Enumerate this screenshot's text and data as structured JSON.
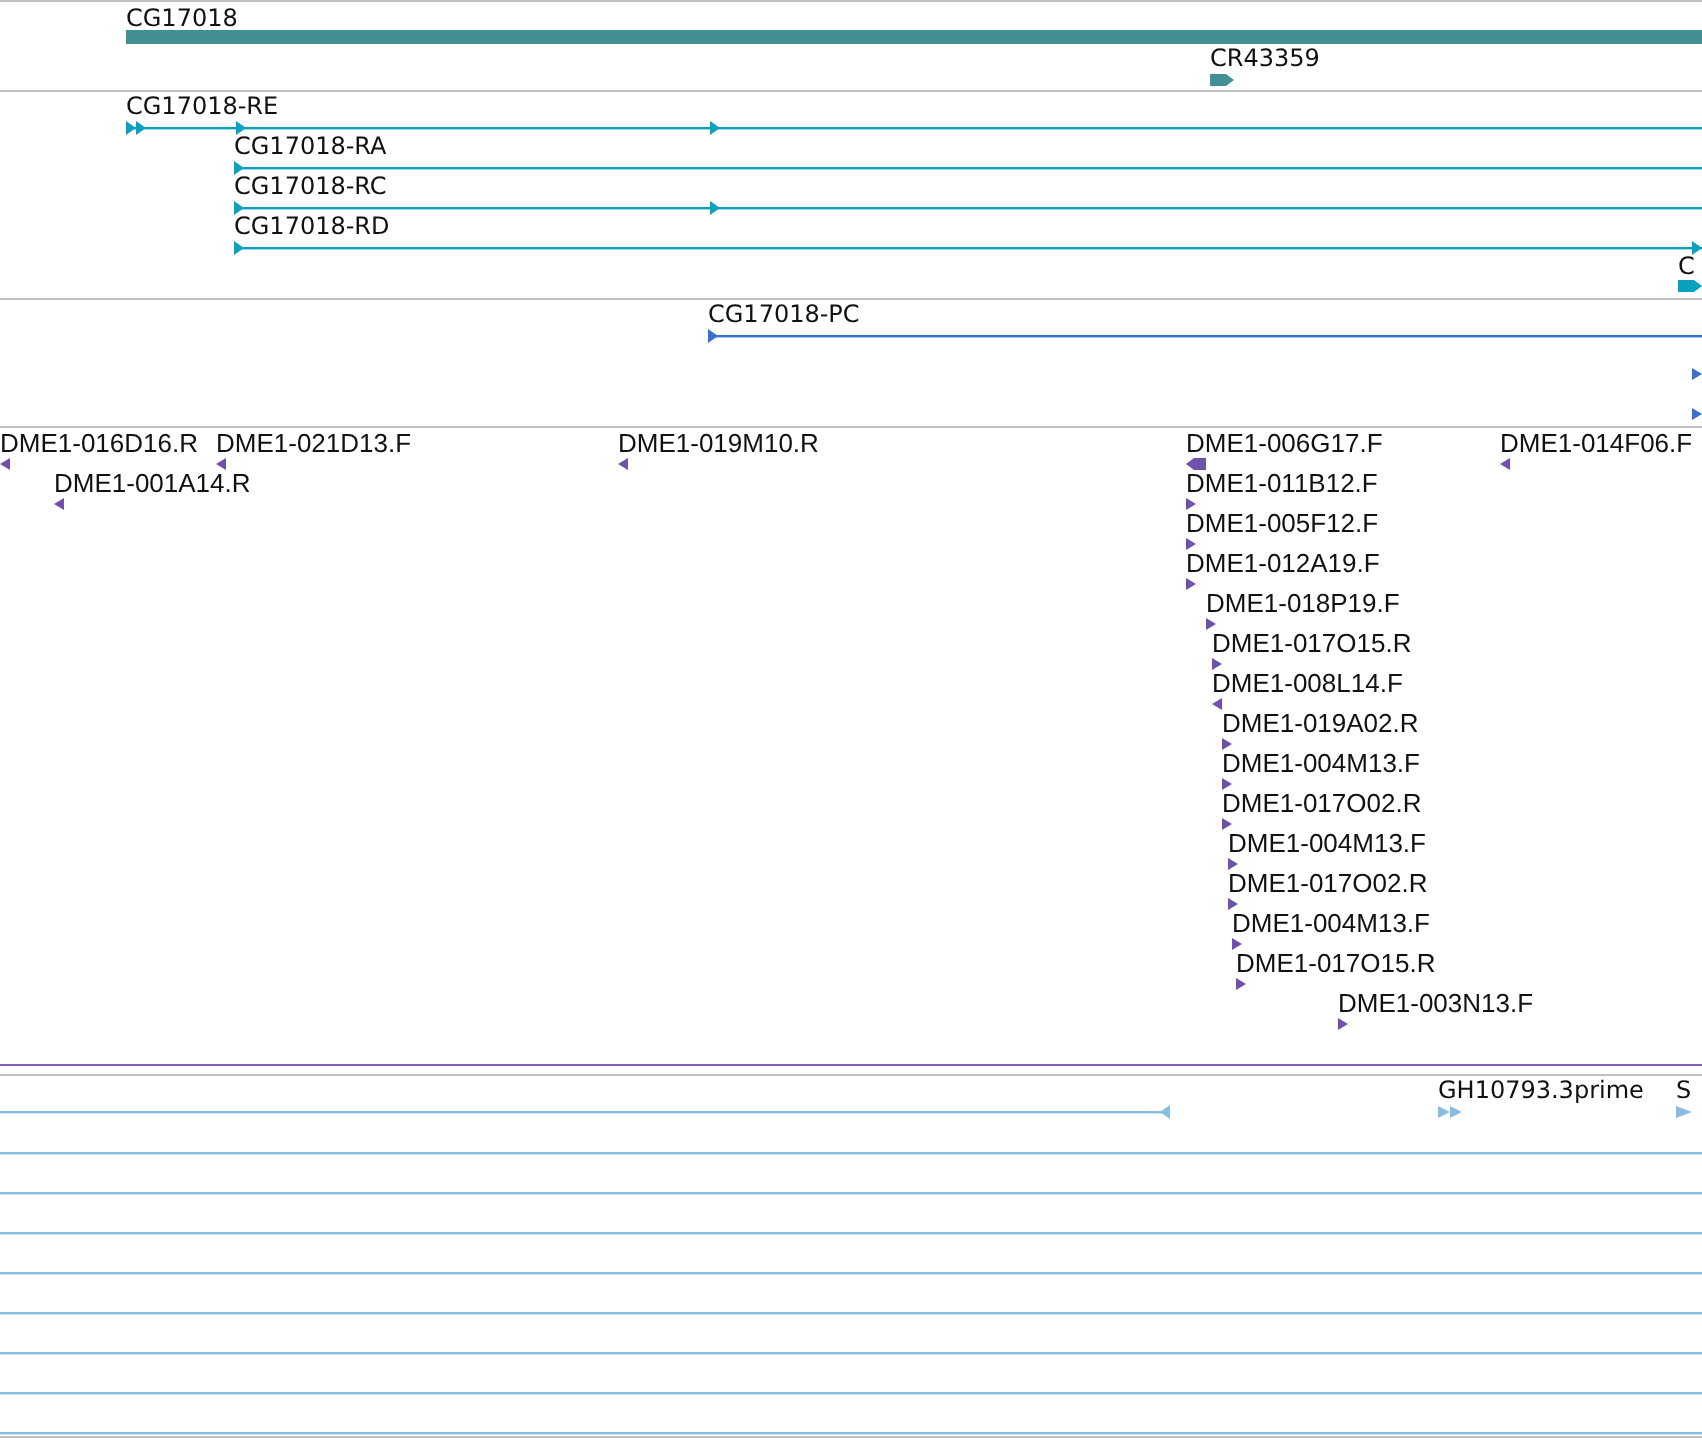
{
  "tracks": [
    {
      "kind": "gene",
      "features": [
        {
          "label": "CG17018",
          "kind": "gene"
        },
        {
          "label": "CR43359",
          "kind": "ncrna",
          "forward": true
        }
      ]
    },
    {
      "kind": "transcript",
      "features": [
        {
          "label": "CG17018-RE",
          "kind": "transcript",
          "forward": true
        },
        {
          "label": "CG17018-RA",
          "kind": "transcript",
          "forward": true
        },
        {
          "label": "CG17018-RC",
          "kind": "transcript",
          "forward": true
        },
        {
          "label": "CG17018-RD",
          "kind": "transcript",
          "forward": true
        },
        {
          "label": "C",
          "kind": "transcript",
          "forward": true
        }
      ]
    },
    {
      "kind": "protein",
      "features": [
        {
          "label": "CG17018-PC",
          "kind": "protein",
          "forward": true
        },
        {
          "kind": "protein",
          "forward": true
        },
        {
          "kind": "protein",
          "forward": true
        }
      ]
    },
    {
      "kind": "est",
      "features": [
        {
          "label": "DME1-016D16.R",
          "kind": "est",
          "forward": false
        },
        {
          "label": "DME1-021D13.F",
          "kind": "est",
          "forward": false
        },
        {
          "label": "DME1-019M10.R",
          "kind": "est",
          "forward": false
        },
        {
          "label": "DME1-006G17.F",
          "kind": "est",
          "forward": false
        },
        {
          "label": "DME1-014F06.F",
          "kind": "est",
          "forward": false
        },
        {
          "label": "DME1-001A14.R",
          "kind": "est",
          "forward": false
        },
        {
          "label": "DME1-011B12.F",
          "kind": "est",
          "forward": true
        },
        {
          "label": "DME1-005F12.F",
          "kind": "est",
          "forward": true
        },
        {
          "label": "DME1-012A19.F",
          "kind": "est",
          "forward": true
        },
        {
          "label": "DME1-018P19.F",
          "kind": "est",
          "forward": true
        },
        {
          "label": "DME1-017O15.R",
          "kind": "est",
          "forward": true
        },
        {
          "label": "DME1-008L14.F",
          "kind": "est",
          "forward": false
        },
        {
          "label": "DME1-019A02.R",
          "kind": "est",
          "forward": true
        },
        {
          "label": "DME1-004M13.F",
          "kind": "est",
          "forward": true
        },
        {
          "label": "DME1-017O02.R",
          "kind": "est",
          "forward": true
        },
        {
          "label": "DME1-004M13.F",
          "kind": "est",
          "forward": true
        },
        {
          "label": "DME1-017O02.R",
          "kind": "est",
          "forward": true
        },
        {
          "label": "DME1-004M13.F",
          "kind": "est",
          "forward": true
        },
        {
          "label": "DME1-017O15.R",
          "kind": "est",
          "forward": true
        },
        {
          "label": "DME1-003N13.F",
          "kind": "est",
          "forward": true
        }
      ]
    },
    {
      "kind": "cdna",
      "features": [
        {
          "kind": "cdna",
          "forward": false
        },
        {
          "label": "GH10793.3prime",
          "kind": "cdna",
          "forward": true
        },
        {
          "label": "S",
          "kind": "cdna",
          "forward": true
        },
        {
          "kind": "cdna"
        },
        {
          "kind": "cdna"
        },
        {
          "kind": "cdna"
        },
        {
          "kind": "cdna"
        },
        {
          "kind": "cdna"
        },
        {
          "kind": "cdna"
        },
        {
          "kind": "cdna"
        },
        {
          "kind": "cdna"
        }
      ]
    }
  ]
}
